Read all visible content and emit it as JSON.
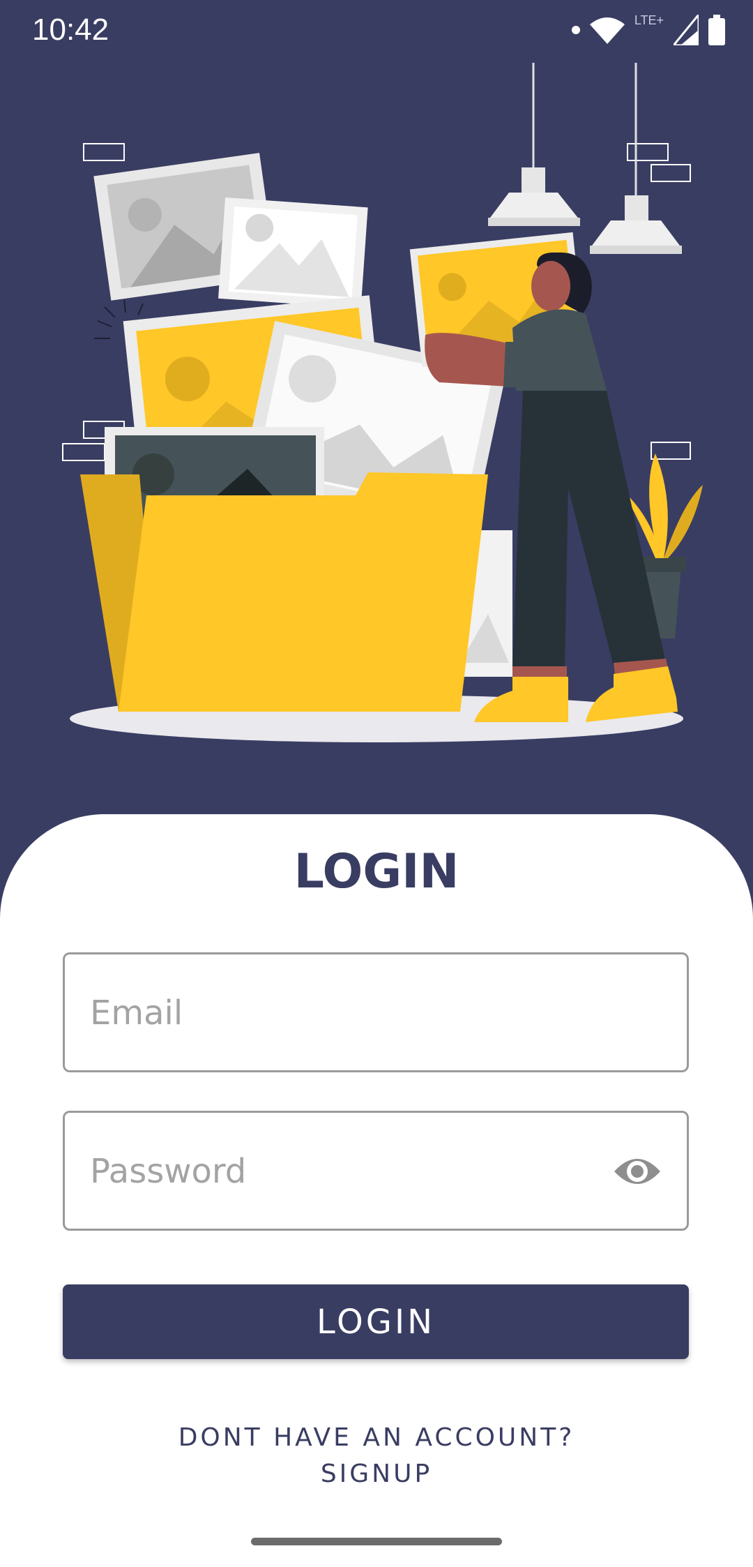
{
  "status_bar": {
    "time": "10:42",
    "network_label": "LTE+",
    "icons": [
      "notification-dot-icon",
      "wifi-icon",
      "signal-icon",
      "battery-icon"
    ]
  },
  "illustration": {
    "subject": "person-holding-photo-folder-illustration"
  },
  "login": {
    "title": "LOGIN",
    "email_placeholder": "Email",
    "email_value": "",
    "password_placeholder": "Password",
    "password_value": "",
    "submit_label": "LOGIN",
    "signup_line1": "DONT HAVE AN ACCOUNT?",
    "signup_line2": "SIGNUP"
  },
  "colors": {
    "primary": "#3a3d62",
    "accent_yellow": "#ffc727",
    "card_bg": "#ffffff",
    "field_border": "#9a9a9a",
    "placeholder": "#a3a3a3"
  }
}
